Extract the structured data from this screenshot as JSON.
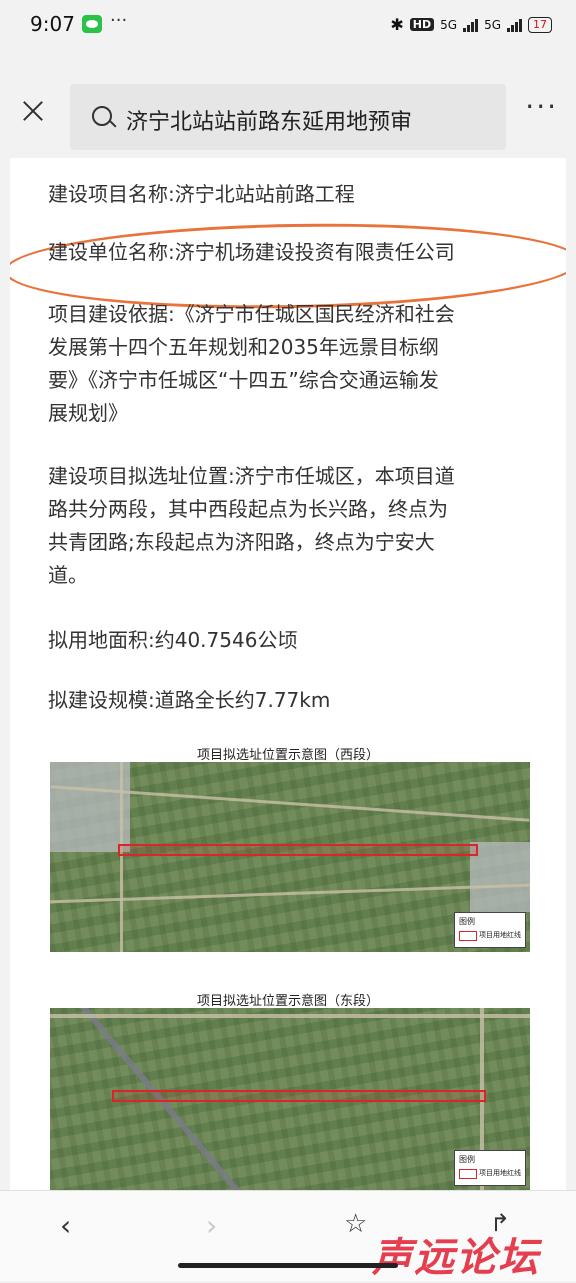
{
  "status_bar": {
    "time": "9:07",
    "more": "···",
    "network_badge": "HD",
    "signal1_label": "5G",
    "signal2_label": "5G",
    "battery": "17"
  },
  "search": {
    "query": "济宁北站站前路东延用地预审",
    "more": "···"
  },
  "article": {
    "project_name": "建设项目名称:济宁北站站前路工程",
    "unit_name": "建设单位名称:济宁机场建设投资有限责任公司",
    "basis_l1": "项目建设依据:《济宁市任城区国民经济和社会",
    "basis_l2": "发展第十四个五年规划和2035年远景目标纲",
    "basis_l3": "要》《济宁市任城区“十四五”综合交通运输发",
    "basis_l4": "展规划》",
    "location_l1": "建设项目拟选址位置:济宁市任城区，本项目道",
    "location_l2": "路共分两段，其中西段起点为长兴路，终点为",
    "location_l3": "共青团路;东段起点为济阳路，终点为宁安大",
    "location_l4": "道。",
    "area": "拟用地面积:约40.7546公顷",
    "scale": "拟建设规模:道路全长约7.77km",
    "map_west_caption": "项目拟选址位置示意图（西段）",
    "map_east_caption": "项目拟选址位置示意图（东段）",
    "legend_title": "图例",
    "legend_label": "项目用地红线"
  },
  "watermark": "声远论坛",
  "colors": {
    "highlight_circle": "#e8743c",
    "route_red": "#d8262a",
    "watermark": "#e53e4f"
  }
}
